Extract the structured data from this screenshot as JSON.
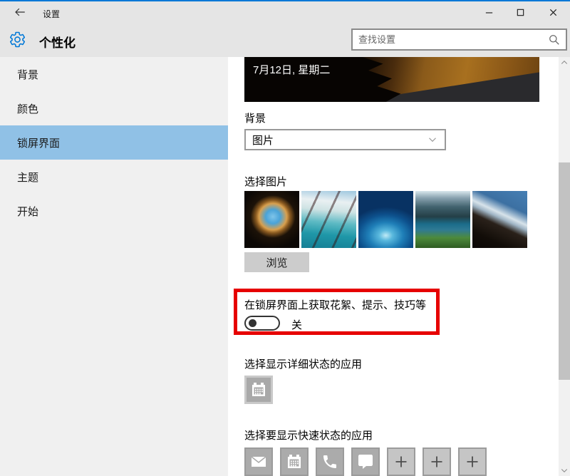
{
  "titlebar": {
    "app_title": "设置"
  },
  "header": {
    "page_title": "个性化",
    "search_placeholder": "查找设置"
  },
  "sidebar": {
    "items": [
      {
        "label": "背景",
        "selected": false
      },
      {
        "label": "颜色",
        "selected": false
      },
      {
        "label": "锁屏界面",
        "selected": true
      },
      {
        "label": "主题",
        "selected": false
      },
      {
        "label": "开始",
        "selected": false
      }
    ]
  },
  "main": {
    "preview": {
      "date_text": "7月12日, 星期二"
    },
    "background_section": {
      "label": "背景",
      "dropdown_value": "图片"
    },
    "choose_picture": {
      "label": "选择图片",
      "thumbnails": [
        "cave-beach",
        "sea-through-glass",
        "ice-cave",
        "mountain-lake",
        "dark-ridge-clouds"
      ],
      "browse_button": "浏览"
    },
    "tips_section": {
      "label": "在锁屏界面上获取花絮、提示、技巧等",
      "toggle_on": false,
      "toggle_state_label": "关"
    },
    "detailed_status": {
      "label": "选择显示详细状态的应用",
      "app_icon": "calendar"
    },
    "quick_status": {
      "label": "选择要显示快速状态的应用",
      "apps": [
        "mail",
        "calendar",
        "phone",
        "messaging",
        "add",
        "add",
        "add"
      ]
    }
  },
  "colors": {
    "accent": "#0078d7",
    "sidebar_highlight": "#90c1e6",
    "annotation_red": "#e60000",
    "titlebar_bg": "#e5e5e5",
    "sidebar_bg": "#f0f0f0"
  }
}
